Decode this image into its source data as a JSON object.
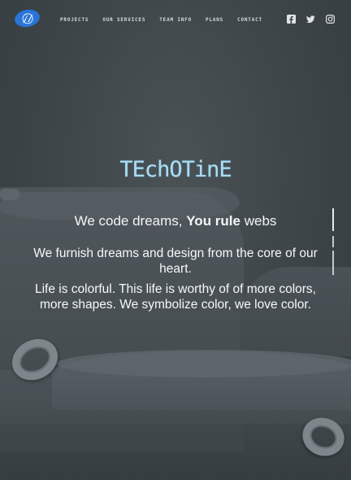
{
  "nav": {
    "links": [
      "PROJECTS",
      "OUR SERVICES",
      "TEAM INFO",
      "PLANS",
      "CONTACT"
    ],
    "socials": [
      "facebook-icon",
      "twitter-icon",
      "instagram-icon"
    ],
    "logo_color": "#2a74d8"
  },
  "hero": {
    "brand": "TEchOTinE",
    "tagline_pre": "We code dreams, ",
    "tagline_bold": "You rule",
    "tagline_post": " webs",
    "para1": "We furnish dreams and design from the core of our heart.",
    "para2": "Life is colorful. This life is worthy of of more colors, more shapes. We symbolize color, we love color."
  },
  "colors": {
    "background": "#3c4448",
    "brand_text": "#a8dcf2",
    "text": "#f3f5f6"
  }
}
